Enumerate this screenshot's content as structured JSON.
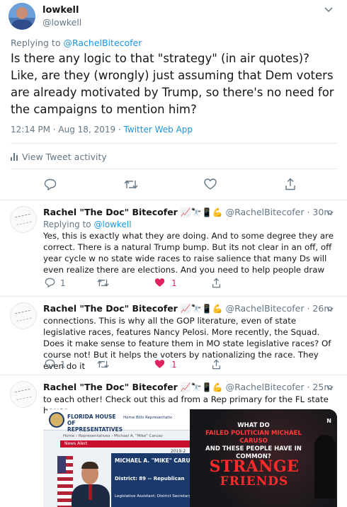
{
  "main_tweet": {
    "author_name": "lowkell",
    "author_handle": "@lowkell",
    "replying_prefix": "Replying to",
    "replying_to": "@RachelBitecofer",
    "text": "Is there any logic to that \"strategy\" (in air quotes)? Like, are they (wrongly) just assuming that Dem voters are already motivated by Trump, so there's no need for the campaigns to mention him?",
    "timestamp": "12:14 PM · Aug 18, 2019 · ",
    "source": "Twitter Web App",
    "activity_label": "View Tweet activity",
    "actions": [
      "reply-icon",
      "retweet-icon",
      "like-icon",
      "share-icon"
    ]
  },
  "replies": [
    {
      "name": "Rachel \"The Doc\" Bitecofer",
      "emojis": "📈🔭📱💪",
      "handle": "@RachelBitecofer",
      "time": " · 30m",
      "replying_prefix": "Replying to",
      "replying_to": "@lowkell",
      "text": "Yes, this is exactly what they are doing. And to some degree they are correct. There is a natural Trump bump. But its not clear in an off, off year cycle w no state wide races to raise salience that many Ds will even realize there are elections. And you need to help people draw",
      "reply_count": "1",
      "like_count": "1"
    },
    {
      "name": "Rachel \"The Doc\" Bitecofer",
      "emojis": "📈🔭📱💪",
      "handle": "@RachelBitecofer",
      "time": " · 26m",
      "text": "connections. This is why all the GOP literature, even of state legislative races, features Nancy Pelosi. More recently, the Squad. Does it make sense to feature them in MO state legislative races? Of course not! But it helps the voters by nationalizing the race. They even do it",
      "reply_count": "1",
      "like_count": "1"
    },
    {
      "name": "Rachel \"The Doc\" Bitecofer",
      "emojis": "📈🔭📱💪",
      "handle": "@RachelBitecofer",
      "time": " · 25m",
      "text": "to each other! Check out this ad from a Rep primary for the FL state house."
    }
  ],
  "media": {
    "left": {
      "site_title": "FLORIDA HOUSE OF REPRESENTATIVES",
      "nav": "Home  Bills  Representativ",
      "breadcrumb": "Home › Representatives › Michael A. \"Mike\" Caruso",
      "news_alert": "News Alert",
      "year": "2019-2",
      "member_name": "MICHAEL A. \"MIKE\" CARU",
      "district": "District: 89 -- Republican",
      "assistant": "Legislative Assistant:   District Secretary"
    },
    "right": {
      "question_1": "WHAT DO",
      "question_red": "FAILED POLITICIAN MICHAEL CARUSO",
      "question_2": "AND THESE PEOPLE HAVE IN COMMON?",
      "title_1": "STRANGE",
      "title_2": "FRIENDS",
      "corner": "N"
    }
  },
  "colors": {
    "link": "#1b95e0",
    "muted": "#657786",
    "like_red": "#e0245e",
    "border": "#e6ecf0"
  }
}
